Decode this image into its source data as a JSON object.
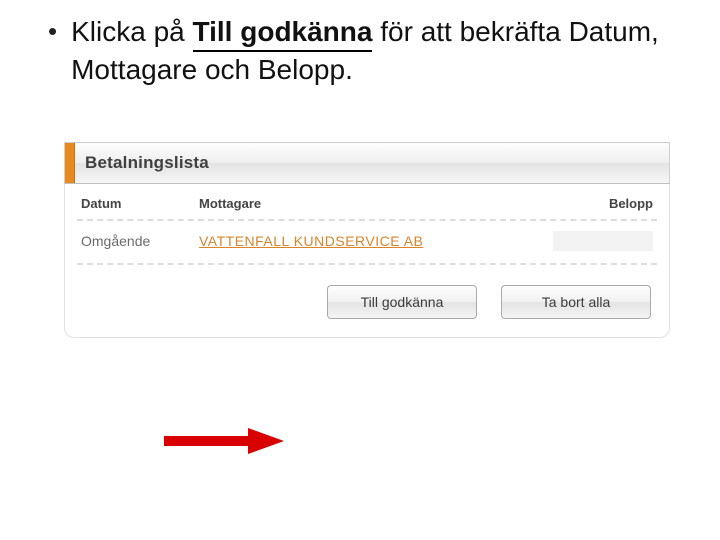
{
  "bullet": {
    "prefix": "Klicka på ",
    "emph": "Till godkänna",
    "suffix": " för att bekräfta Datum, Mottagare och Belopp."
  },
  "panel": {
    "title": "Betalningslista",
    "columns": {
      "datum": "Datum",
      "mottagare": "Mottagare",
      "belopp": "Belopp"
    },
    "row0": {
      "datum": "Omgående",
      "mottagare": "VATTENFALL KUNDSERVICE AB",
      "belopp": ""
    },
    "buttons": {
      "approve": "Till godkänna",
      "remove_all": "Ta bort alla"
    }
  }
}
